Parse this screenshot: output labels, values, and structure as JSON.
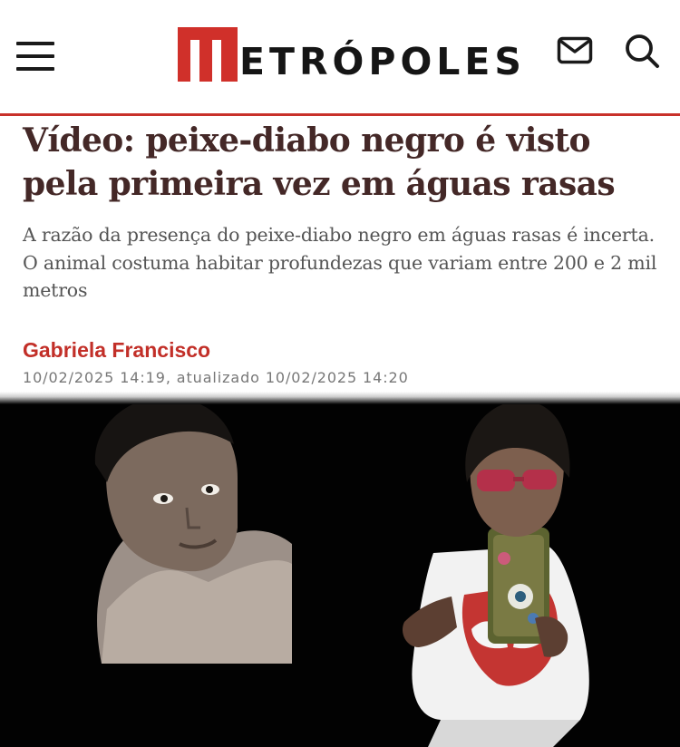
{
  "header": {
    "brand": "METRÓPOLES",
    "brand_rest": "ETRÓPOLES",
    "icons": [
      "menu-icon",
      "mail-icon",
      "search-icon"
    ],
    "accent_color": "#c8312a"
  },
  "article": {
    "headline": "Vídeo: peixe-diabo negro é visto pela primeira vez em águas rasas",
    "subtitle": "A razão da presença do peixe-diabo negro em águas rasas é incerta. O animal costuma habitar profundezas que variam entre 200 e 2 mil metros",
    "author": "Gabriela Francisco",
    "date": "10/02/2025 14:19, atualizado 10/02/2025 14:20"
  },
  "colors": {
    "headline": "#442827",
    "author": "#c22f28",
    "photo_bg": "#020202"
  }
}
